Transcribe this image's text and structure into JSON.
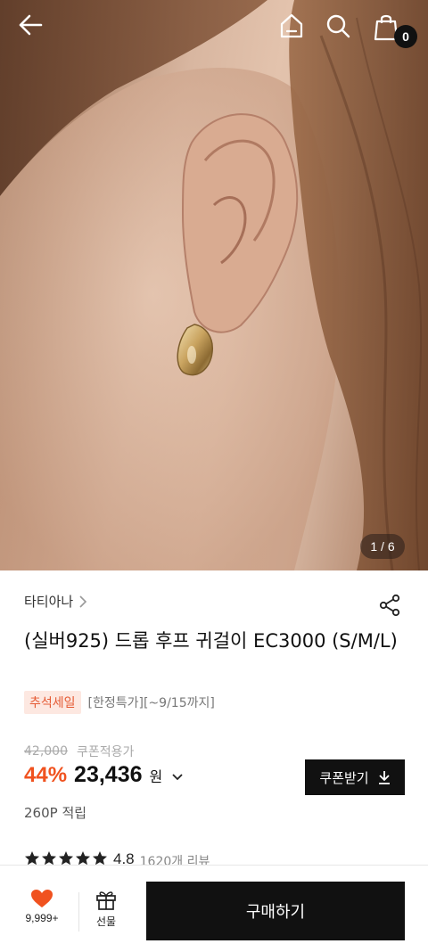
{
  "header": {
    "cart_count": "0",
    "icons": [
      "back-arrow-icon",
      "home-icon",
      "search-icon",
      "shopping-bag-icon"
    ]
  },
  "gallery": {
    "counter": "1 / 6"
  },
  "product": {
    "brand": "타티아나",
    "title": "(실버925) 드롭 후프 귀걸이 EC3000 (S/M/L)",
    "badge": "추석세일",
    "badge_note": "[한정특가][~9/15까지]",
    "original_price": "42,000",
    "coupon_price_label": "쿠폰적용가",
    "discount": "44%",
    "price": "23,436",
    "currency": "원",
    "coupon_button": "쿠폰받기",
    "points": "260P 적립",
    "rating": "4.8",
    "review_count": "1620개 리뷰"
  },
  "bottom_bar": {
    "like_count": "9,999+",
    "gift_label": "선물",
    "buy_label": "구매하기"
  },
  "colors": {
    "accent": "#f0521f",
    "badge_bg": "#fde8e1",
    "dark": "#111111"
  }
}
